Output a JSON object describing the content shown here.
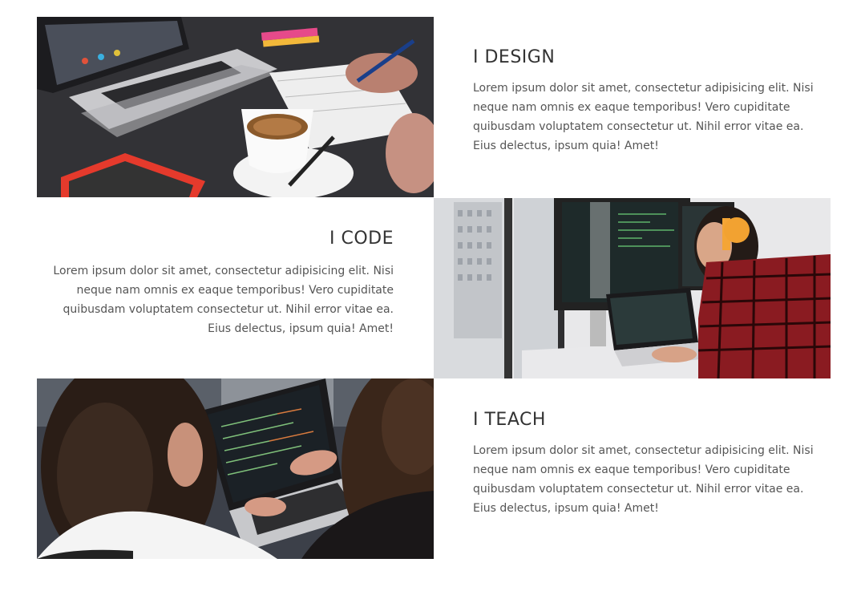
{
  "sections": [
    {
      "title": "I DESIGN",
      "body": "Lorem ipsum dolor sit amet, consectetur adipisicing elit. Nisi neque nam omnis ex eaque temporibus! Vero cupiditate quibusdam voluptatem consectetur ut. Nihil error vitae ea. Eius delectus, ipsum quia! Amet!",
      "image": "laptop-coffee-notebook-photo"
    },
    {
      "title": "I CODE",
      "body": "Lorem ipsum dolor sit amet, consectetur adipisicing elit. Nisi neque nam omnis ex eaque temporibus! Vero cupiditate quibusdam voluptatem consectetur ut. Nihil error vitae ea. Eius delectus, ipsum quia! Amet!",
      "image": "developer-monitors-headphones-photo"
    },
    {
      "title": "I TEACH",
      "body": "Lorem ipsum dolor sit amet, consectetur adipisicing elit. Nisi neque nam omnis ex eaque temporibus! Vero cupiditate quibusdam voluptatem consectetur ut. Nihil error vitae ea. Eius delectus, ipsum quia! Amet!",
      "image": "two-people-laptop-photo"
    }
  ]
}
